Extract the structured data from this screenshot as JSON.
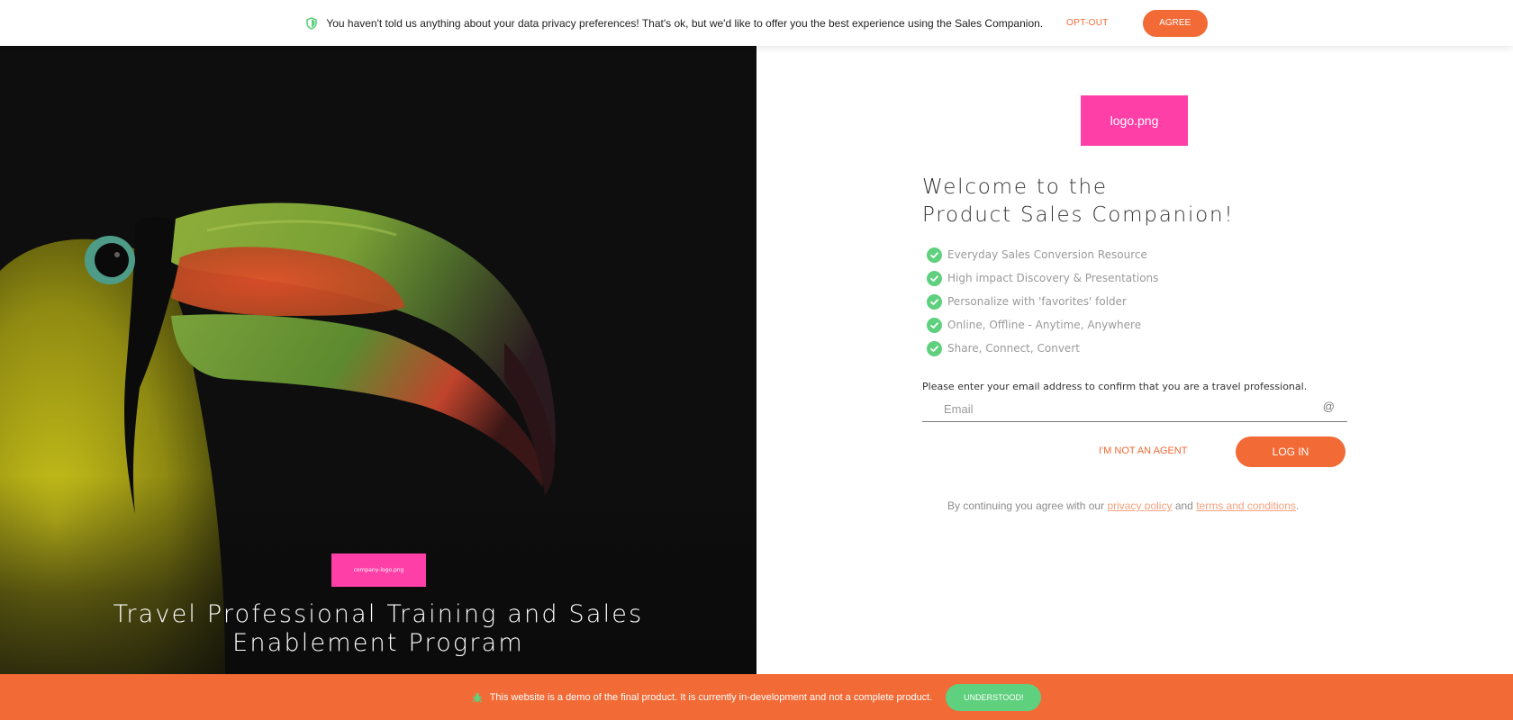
{
  "privacy_banner": {
    "message": "You haven't told us anything about your data privacy preferences! That's ok, but we'd like to offer you the best experience using the Sales Companion.",
    "opt_out_label": "OPT-OUT",
    "agree_label": "AGREE",
    "icon": "shield-icon"
  },
  "hero": {
    "company_logo_text": "company-logo.png",
    "title": "Travel Professional Training and Sales Enablement Program"
  },
  "login": {
    "logo_text": "logo.png",
    "welcome_line1": "Welcome to the",
    "welcome_line2": "Product Sales Companion!",
    "features": [
      "Everyday Sales Conversion Resource",
      "High impact Discovery & Presentations",
      "Personalize with 'favorites' folder",
      "Online, Offline - Anytime, Anywhere",
      "Share, Connect, Convert"
    ],
    "email_prompt": "Please enter your email address to confirm that you are a travel professional.",
    "email_placeholder": "Email",
    "email_value": "",
    "at_symbol": "@",
    "not_agent_label": "I'M NOT AN AGENT",
    "login_label": "LOG IN",
    "terms_prefix": "By continuing you agree with our",
    "privacy_link": "privacy policy",
    "terms_and": "and",
    "terms_link": "terms and conditions",
    "terms_suffix": "."
  },
  "demo_banner": {
    "message": "This website is a demo of the final product. It is currently in-development and not a complete product.",
    "understood_label": "UNDERSTOOD!",
    "icon": "bug-icon"
  },
  "colors": {
    "accent": "#f26a35",
    "success": "#5fd07e",
    "placeholder_pink": "#fe3fa7"
  }
}
